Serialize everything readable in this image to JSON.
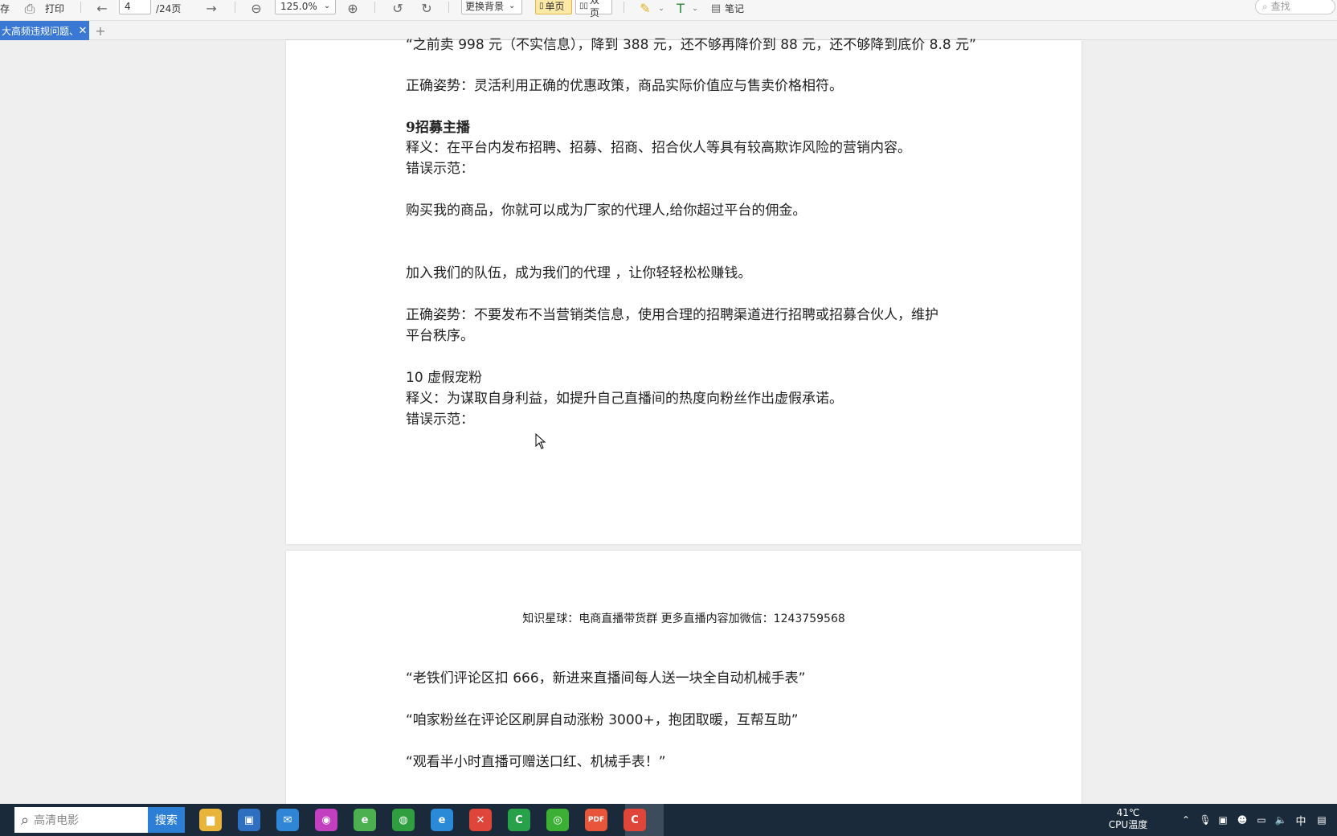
{
  "toolbar": {
    "save_partial": "存",
    "print_label": "打印",
    "page_current": "4",
    "page_total": "/24页",
    "zoom": "125.0%",
    "background_label": "更换背景",
    "single_page_label": "单页",
    "double_page_label": "双页",
    "notes_label": "笔记",
    "search_placeholder": "查找"
  },
  "tabs": [
    {
      "label": "大高频违规问题、"
    }
  ],
  "page1": {
    "lines": [
      "“之前卖 998 元（不实信息），降到 388 元，还不够再降价到 88 元，还不够降到底价 8.8 元”",
      "正确姿势：灵活利用正确的优惠政策，商品实际价值应与售卖价格相符。",
      "9招募主播",
      "释义：在平台内发布招聘、招募、招商、招合伙人等具有较高欺诈风险的营销内容。",
      "错误示范：",
      "购买我的商品，你就可以成为厂家的代理人,给你超过平台的佣金。",
      "加入我们的队伍，成为我们的代理 ，让你轻轻松松赚钱。",
      " 正确姿势：不要发布不当营销类信息，使用合理的招聘渠道进行招聘或招募合伙人，维护",
      "平台秩序。",
      "10 虚假宠粉",
      "释义：为谋取自身利益，如提升自己直播间的热度向粉丝作出虚假承诺。",
      "错误示范："
    ]
  },
  "page2": {
    "watermark": "知识星球：电商直播带货群   更多直播内容加微信：1243759568",
    "lines": [
      "“老铁们评论区扣 666，新进来直播间每人送一块全自动机械手表”",
      "“咱家粉丝在评论区刷屏自动涨粉 3000+，抱团取暖，互帮互助”",
      "“观看半小时直播可赠送口红、机械手表！”"
    ]
  },
  "taskbar": {
    "search_placeholder": "高清电影",
    "search_button": "搜索",
    "apps": [
      {
        "name": "file-explorer-icon",
        "color": "#e8b43a",
        "glyph": "▆"
      },
      {
        "name": "store-icon",
        "color": "#2f6fc1",
        "glyph": "▣"
      },
      {
        "name": "mail-icon",
        "color": "#2f86d6",
        "glyph": "✉"
      },
      {
        "name": "photos-icon",
        "color": "#c23fbf",
        "glyph": "◉"
      },
      {
        "name": "browser-360-icon",
        "color": "#4caf50",
        "glyph": "e"
      },
      {
        "name": "chat-app-icon",
        "color": "#2e9e3f",
        "glyph": "◍"
      },
      {
        "name": "ie-browser-icon",
        "color": "#2a8ad8",
        "glyph": "e"
      },
      {
        "name": "office-icon",
        "color": "#e0453a",
        "glyph": "✕"
      },
      {
        "name": "camtasia-icon",
        "color": "#27a24a",
        "glyph": "C"
      },
      {
        "name": "wechat-icon",
        "color": "#3cb034",
        "glyph": "◎"
      },
      {
        "name": "pdf-icon",
        "color": "#e8553a",
        "glyph": "PDF"
      },
      {
        "name": "recorder-icon",
        "color": "#e0453a",
        "glyph": "C"
      }
    ],
    "temp_value": "41℃",
    "temp_label": "CPU温度",
    "ime_label": "中"
  }
}
